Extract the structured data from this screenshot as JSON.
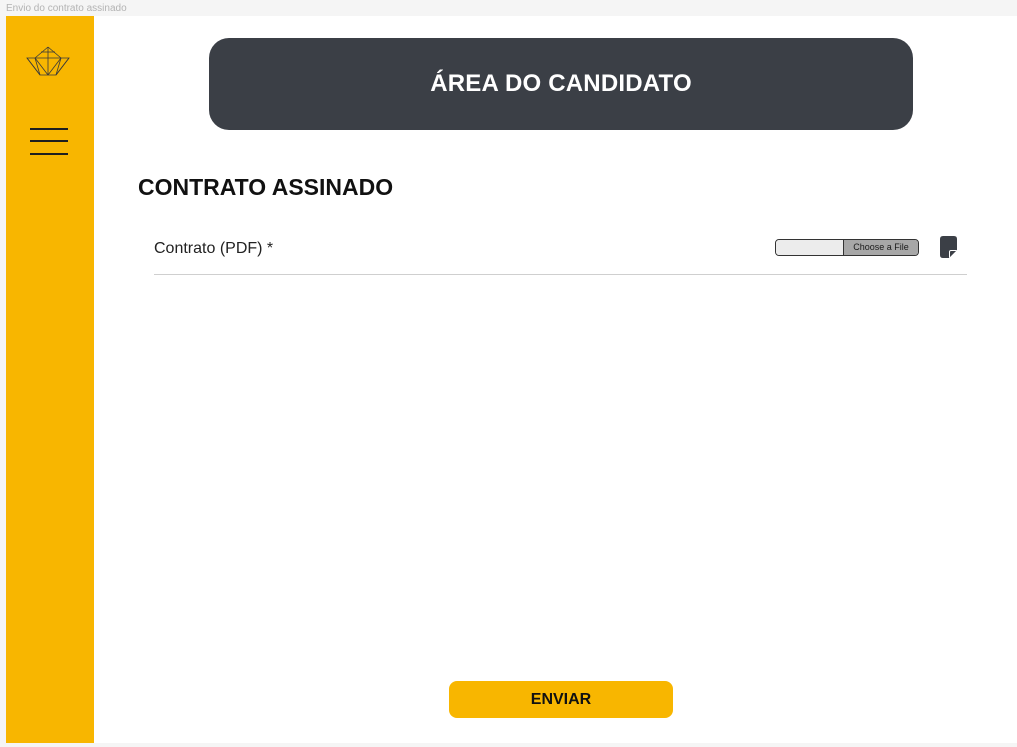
{
  "frame": {
    "label": "Envio do contrato assinado"
  },
  "sidebar": {
    "logo_icon": "geometric-crown-logo-icon",
    "menu_icon": "hamburger-menu-icon",
    "color": "#f8b600"
  },
  "header": {
    "title": "ÁREA DO CANDIDATO",
    "color": "#3b3f46"
  },
  "section": {
    "title": "CONTRATO ASSINADO"
  },
  "form": {
    "fields": [
      {
        "label": "Contrato (PDF) *",
        "file_button_label": "Choose a File",
        "file_name": "",
        "icon": "document-icon"
      }
    ]
  },
  "actions": {
    "submit_label": "ENVIAR",
    "submit_color": "#f8b600"
  }
}
